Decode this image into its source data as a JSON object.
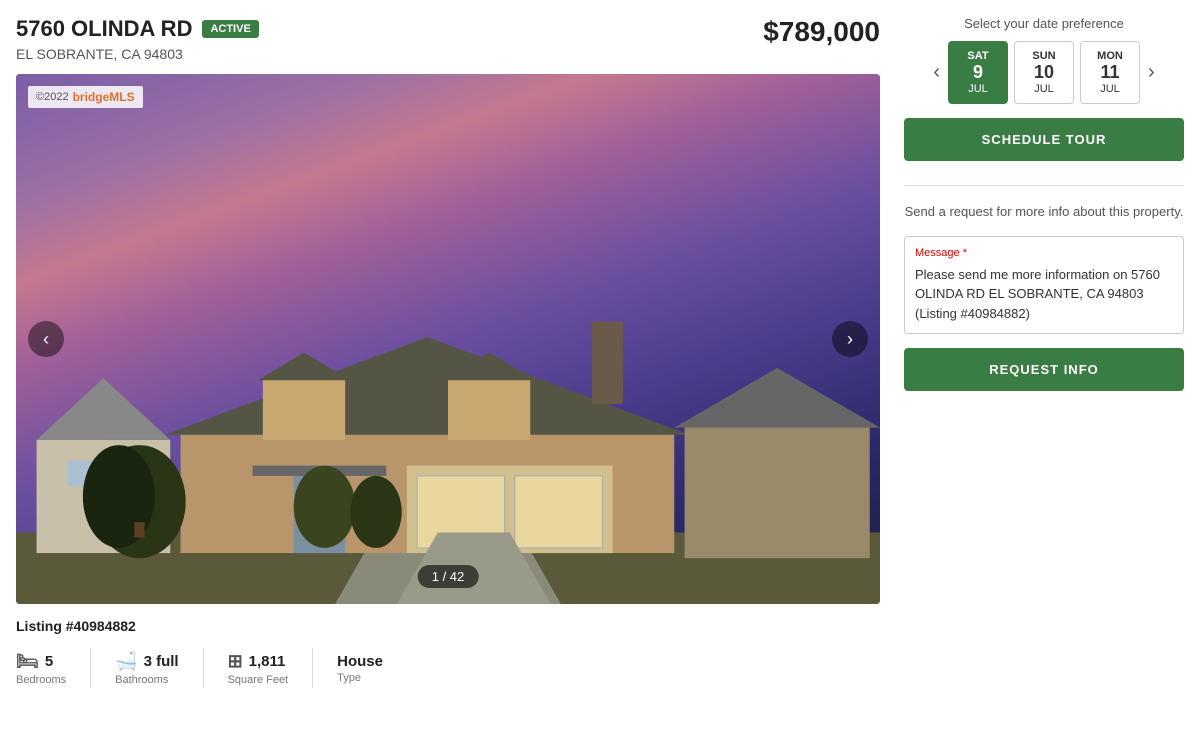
{
  "header": {
    "address_line1": "5760 OLINDA RD",
    "status_badge": "ACTIVE",
    "address_line2": "EL SOBRANTE, CA 94803",
    "price": "$789,000"
  },
  "gallery": {
    "copyright": "©2022",
    "logo": "bridgeMLS",
    "image_counter": "1 / 42",
    "prev_label": "‹",
    "next_label": "›"
  },
  "listing": {
    "number": "Listing #40984882",
    "bedrooms_icon": "🛏",
    "bedrooms_count": "5",
    "bedrooms_label": "Bedrooms",
    "bathrooms_icon": "🛁",
    "bathrooms_count": "3 full",
    "bathrooms_label": "Bathrooms",
    "sqft_icon": "⊞",
    "sqft_count": "1,811",
    "sqft_label": "Square Feet",
    "type": "House",
    "type_label": "Type"
  },
  "sidebar": {
    "date_pref_label": "Select your date preference",
    "dates": [
      {
        "day_name": "SAT",
        "day_num": "JUL 9",
        "selected": true
      },
      {
        "day_name": "SUN",
        "day_num": "JUL 10",
        "selected": false
      },
      {
        "day_name": "MON",
        "day_num": "JUL 11",
        "selected": false
      }
    ],
    "schedule_btn": "SCHEDULE TOUR",
    "request_info_text": "Send a request for more info about this property.",
    "message_label": "Message",
    "message_text": "Please send me more information on 5760 OLINDA RD EL SOBRANTE, CA 94803 (Listing #40984882)",
    "request_btn": "REQUEST INFO"
  }
}
